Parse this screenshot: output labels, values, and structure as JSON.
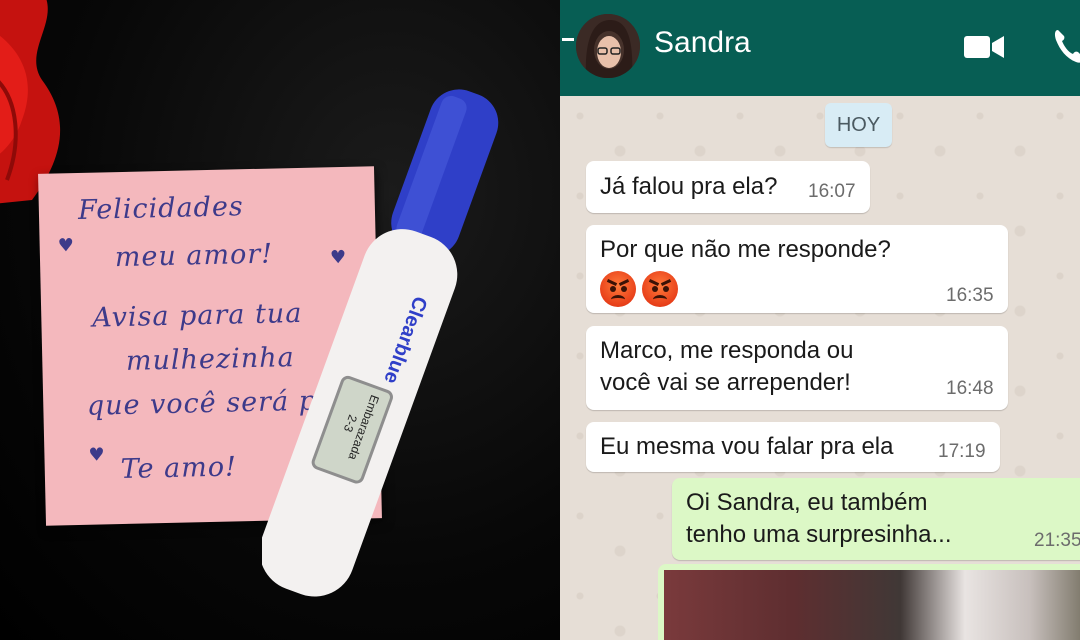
{
  "left_photo": {
    "note_lines": [
      "Felicidades",
      "meu amor!",
      "Avisa para tua",
      "mulhezinha",
      "que você será pai",
      "Te amo!"
    ],
    "test_brand": "Clearblue",
    "test_display_lines": [
      "Embarazada",
      "2-3"
    ]
  },
  "chat": {
    "contact_name": "Sandra",
    "date_chip": "HOY",
    "icons": {
      "back": "back-arrow-icon",
      "video": "video-call-icon",
      "phone": "phone-call-icon",
      "emoji": "angry-face-emoji"
    },
    "messages": [
      {
        "direction": "in",
        "lines": [
          "Já falou pra ela?"
        ],
        "time": "16:07"
      },
      {
        "direction": "in",
        "lines": [
          "Por que não me responde?"
        ],
        "emoji_count": 2,
        "time": "16:35"
      },
      {
        "direction": "in",
        "lines": [
          "Marco, me responda ou",
          "você vai se arrepender!"
        ],
        "time": "16:48"
      },
      {
        "direction": "in",
        "lines": [
          "Eu mesma vou falar pra ela"
        ],
        "time": "17:19"
      },
      {
        "direction": "out",
        "lines": [
          "Oi Sandra, eu também",
          "tenho uma surpresinha..."
        ],
        "time": "21:35"
      }
    ],
    "colors": {
      "header": "#075e54",
      "incoming_bubble": "#ffffff",
      "outgoing_bubble": "#dcf8c6",
      "background": "#e5ddd5",
      "date_chip": "#d8ecf5"
    }
  }
}
